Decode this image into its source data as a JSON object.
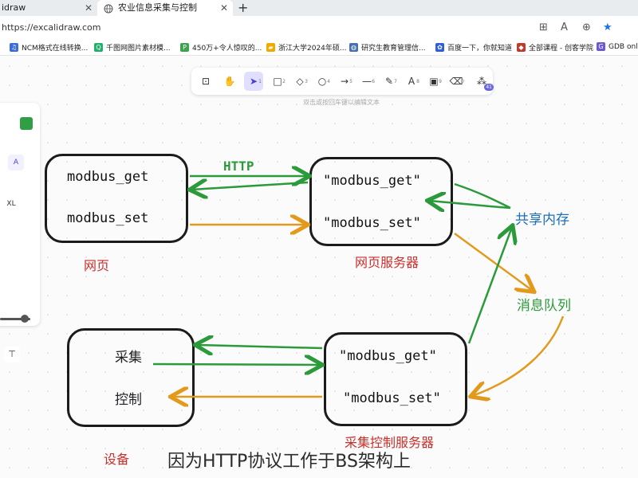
{
  "browser": {
    "tabs": [
      {
        "label": "idraw",
        "close": "✕"
      },
      {
        "label": "农业信息采集与控制",
        "close": "✕"
      }
    ],
    "new_tab": "+",
    "url": "https://excalidraw.com",
    "bookmarks": [
      {
        "label": "NCM格式在线转换...",
        "icon_color": "#3a6fd8",
        "icon": "music-icon",
        "glyph": "♫"
      },
      {
        "label": "千图网图片素材模...",
        "icon_color": "#20b06b",
        "icon": "qiantu-icon",
        "glyph": "Q"
      },
      {
        "label": "450万+令人惊叹的...",
        "icon_color": "#3fa34d",
        "icon": "image-site-icon",
        "glyph": "P"
      },
      {
        "label": "浙江大学2024年硕...",
        "icon_color": "#f2a900",
        "icon": "folder-icon",
        "glyph": "▰"
      },
      {
        "label": "研究生教育管理信...",
        "icon_color": "#4a6fb0",
        "icon": "university-icon",
        "glyph": "◍"
      },
      {
        "label": "百度一下，你就知道",
        "icon_color": "#2f5ed8",
        "icon": "baidu-paw-icon",
        "glyph": "✿"
      },
      {
        "label": "全部课程 - 创客学院",
        "icon_color": "#c0392b",
        "icon": "course-icon",
        "glyph": "◆"
      },
      {
        "label": "GDB online",
        "icon_color": "#6b5bd2",
        "icon": "gdb-icon",
        "glyph": "G"
      }
    ]
  },
  "toolbar": {
    "tools": [
      {
        "name": "lock-tool",
        "glyph": "⊡",
        "sub": ""
      },
      {
        "name": "hand-tool",
        "glyph": "✋",
        "sub": ""
      },
      {
        "name": "selection-tool",
        "glyph": "➤",
        "sub": "1"
      },
      {
        "name": "rectangle-tool",
        "glyph": "□",
        "sub": "2"
      },
      {
        "name": "diamond-tool",
        "glyph": "◇",
        "sub": "3"
      },
      {
        "name": "ellipse-tool",
        "glyph": "○",
        "sub": "4"
      },
      {
        "name": "arrow-tool",
        "glyph": "→",
        "sub": "5"
      },
      {
        "name": "line-tool",
        "glyph": "—",
        "sub": "6"
      },
      {
        "name": "draw-tool",
        "glyph": "✎",
        "sub": "7"
      },
      {
        "name": "text-tool",
        "glyph": "A",
        "sub": "8"
      },
      {
        "name": "image-tool",
        "glyph": "▣",
        "sub": "9"
      },
      {
        "name": "eraser-tool",
        "glyph": "⌫",
        "sub": "0"
      },
      {
        "name": "extra-tools",
        "glyph": "⁂",
        "sub": ""
      }
    ],
    "badge": "41",
    "hint": "双击或按回车键以编辑文本"
  },
  "panel": {
    "stroke_colors": [
      "#f5a000",
      "#2f9e44"
    ],
    "font_family_label": "A",
    "font_size_label": "XL",
    "align_label": "⊤"
  },
  "diagram": {
    "web_box": {
      "line1": "modbus_get",
      "line2": "modbus_set",
      "label": "网页"
    },
    "web_server_box": {
      "line1": "\"modbus_get\"",
      "line2": "\"modbus_set\"",
      "label": "网页服务器"
    },
    "device_box": {
      "line1": "采集",
      "line2": "控制",
      "label": "设备"
    },
    "ctrl_server_box": {
      "line1": "\"modbus_get\"",
      "line2": "\"modbus_set\"",
      "label": "采集控制服务器"
    },
    "http_label": "HTTP",
    "shared_memory": "共享内存",
    "message_queue": "消息队列",
    "caption": "因为HTTP协议工作于BS架构上",
    "colors": {
      "green": "#2a9a3a",
      "orange": "#e39a1c",
      "blue": "#1d6fb8",
      "red": "#c9302c"
    }
  }
}
